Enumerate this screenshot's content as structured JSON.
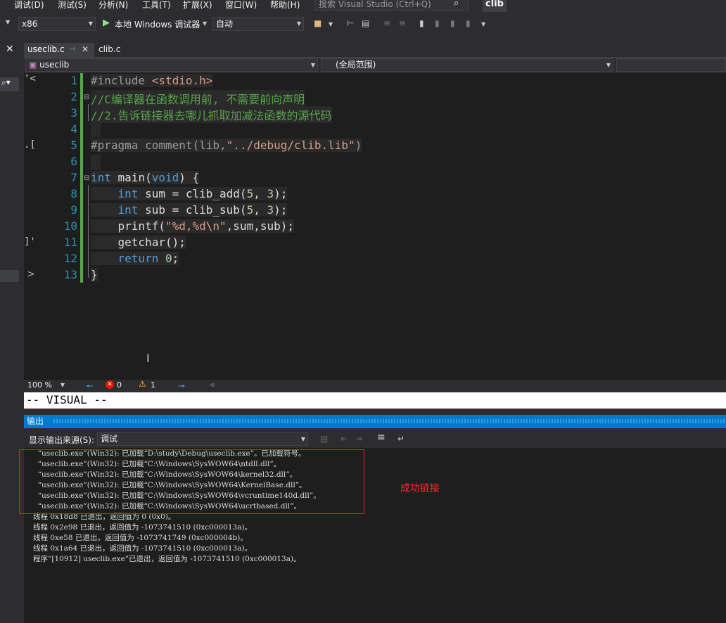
{
  "menu": [
    "调试(D)",
    "测试(S)",
    "分析(N)",
    "工具(T)",
    "扩展(X)",
    "窗口(W)",
    "帮助(H)"
  ],
  "search_placeholder": "搜索 Visual Studio (Ctrl+Q)",
  "window_title": "clib",
  "toolbar": {
    "platform": "x86",
    "run_label": "本地 Windows 调试器",
    "run_mode": "自动"
  },
  "tabs": [
    {
      "label": "useclib.c",
      "active": true
    },
    {
      "label": "clib.c",
      "active": false
    }
  ],
  "nav": {
    "project": "useclib",
    "scope": "(全局范围)"
  },
  "code_lines": [
    {
      "n": "1",
      "t": "#include <stdio.h>"
    },
    {
      "n": "2",
      "t": "//C编译器在函数调用前, 不需要前向声明"
    },
    {
      "n": "3",
      "t": "//2.告诉链接器去哪儿抓取加减法函数的源代码"
    },
    {
      "n": "4",
      "t": ""
    },
    {
      "n": "5",
      "t": "#pragma comment(lib,\"../debug/clib.lib\")"
    },
    {
      "n": "6",
      "t": ""
    },
    {
      "n": "7",
      "t": "int main(void) {"
    },
    {
      "n": "8",
      "t": "    int sum = clib_add(5, 3);"
    },
    {
      "n": "9",
      "t": "    int sub = clib_sub(5, 3);"
    },
    {
      "n": "10",
      "t": "    printf(\"%d,%d\\n\",sum,sub);"
    },
    {
      "n": "11",
      "t": "    getchar();"
    },
    {
      "n": "12",
      "t": "    return 0;"
    },
    {
      "n": "13",
      "t": "}"
    }
  ],
  "status": {
    "zoom": "100 %",
    "errors": "0",
    "warnings": "1"
  },
  "command_line": "-- VISUAL --",
  "output": {
    "title": "输出",
    "source_label": "显示输出来源(S):",
    "source_value": "调试",
    "lines": [
      "  “useclib.exe”(Win32): 已加载“D:\\study\\Debug\\useclib.exe”。已加载符号。",
      "  “useclib.exe”(Win32): 已加载“C:\\Windows\\SysWOW64\\ntdll.dll”。",
      "  “useclib.exe”(Win32): 已加载“C:\\Windows\\SysWOW64\\kernel32.dll”。",
      "  “useclib.exe”(Win32): 已加载“C:\\Windows\\SysWOW64\\KernelBase.dll”。",
      "  “useclib.exe”(Win32): 已加载“C:\\Windows\\SysWOW64\\vcruntime140d.dll”。",
      "  “useclib.exe”(Win32): 已加载“C:\\Windows\\SysWOW64\\ucrtbased.dll”。",
      "线程 0x18d8 已退出，返回值为 0 (0x0)。",
      "线程 0x2e98 已退出，返回值为 -1073741510 (0xc000013a)。",
      "线程 0xe58 已退出，返回值为 -1073741749 (0xc000004b)。",
      "线程 0x1a64 已退出，返回值为 -1073741510 (0xc000013a)。",
      "程序“[10912] useclib.exe”已退出，返回值为 -1073741510 (0xc000013a)。"
    ]
  },
  "annotation": "成功链接",
  "colors": {
    "accent": "#007acc",
    "annotation": "#ff2a2a",
    "editor_bg": "#1e1e1e"
  }
}
